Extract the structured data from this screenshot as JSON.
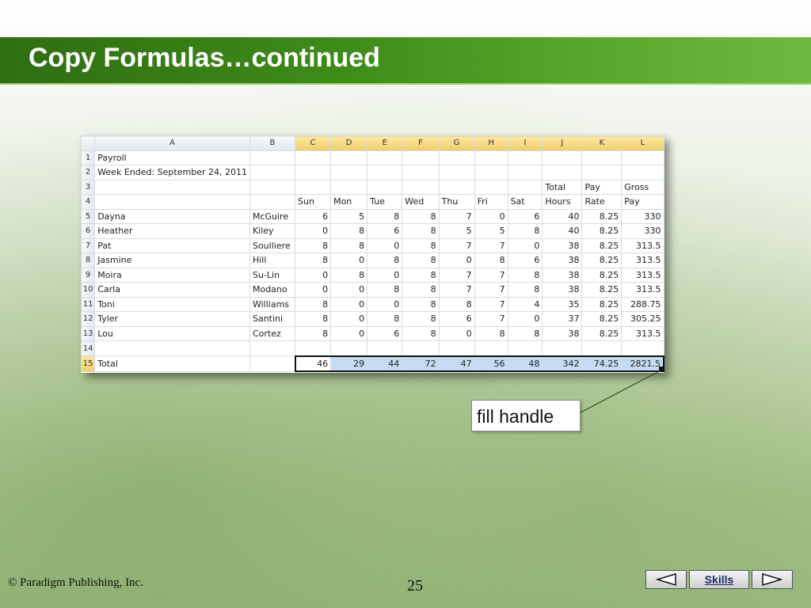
{
  "slide": {
    "title": "Copy Formulas…continued",
    "footer_copyright": "© Paradigm Publishing, Inc.",
    "page_number": "25",
    "callout": "fill handle",
    "nav": {
      "prev_icon": "left-triangle-icon",
      "skills_label": "Skills",
      "next_icon": "right-triangle-icon"
    },
    "colors": {
      "title_bar": "#3d8a19",
      "selection": "#c6dbf3",
      "header_selected": "#f2cd6a"
    }
  },
  "sheet": {
    "columns": [
      "A",
      "B",
      "C",
      "D",
      "E",
      "F",
      "G",
      "H",
      "I",
      "J",
      "K",
      "L"
    ],
    "rows": [
      {
        "n": "1",
        "cells": [
          "Payroll",
          "",
          "",
          "",
          "",
          "",
          "",
          "",
          "",
          "",
          "",
          ""
        ]
      },
      {
        "n": "2",
        "cells": [
          "Week Ended: September 24, 2011",
          "",
          "",
          "",
          "",
          "",
          "",
          "",
          "",
          "",
          "",
          ""
        ]
      },
      {
        "n": "3",
        "cells": [
          "",
          "",
          "",
          "",
          "",
          "",
          "",
          "",
          "",
          "Total",
          "Pay",
          "Gross"
        ]
      },
      {
        "n": "4",
        "cells": [
          "",
          "",
          "Sun",
          "Mon",
          "Tue",
          "Wed",
          "Thu",
          "Fri",
          "Sat",
          "Hours",
          "Rate",
          "Pay"
        ]
      },
      {
        "n": "5",
        "cells": [
          "Dayna",
          "McGuire",
          "6",
          "5",
          "8",
          "8",
          "7",
          "0",
          "6",
          "40",
          "8.25",
          "330"
        ]
      },
      {
        "n": "6",
        "cells": [
          "Heather",
          "Kiley",
          "0",
          "8",
          "6",
          "8",
          "5",
          "5",
          "8",
          "40",
          "8.25",
          "330"
        ]
      },
      {
        "n": "7",
        "cells": [
          "Pat",
          "Soulliere",
          "8",
          "8",
          "0",
          "8",
          "7",
          "7",
          "0",
          "38",
          "8.25",
          "313.5"
        ]
      },
      {
        "n": "8",
        "cells": [
          "Jasmine",
          "Hill",
          "8",
          "0",
          "8",
          "8",
          "0",
          "8",
          "6",
          "38",
          "8.25",
          "313.5"
        ]
      },
      {
        "n": "9",
        "cells": [
          "Moira",
          "Su-Lin",
          "0",
          "8",
          "0",
          "8",
          "7",
          "7",
          "8",
          "38",
          "8.25",
          "313.5"
        ]
      },
      {
        "n": "10",
        "cells": [
          "Carla",
          "Modano",
          "0",
          "0",
          "8",
          "8",
          "7",
          "7",
          "8",
          "38",
          "8.25",
          "313.5"
        ]
      },
      {
        "n": "11",
        "cells": [
          "Toni",
          "Williams",
          "8",
          "0",
          "0",
          "8",
          "8",
          "7",
          "4",
          "35",
          "8.25",
          "288.75"
        ]
      },
      {
        "n": "12",
        "cells": [
          "Tyler",
          "Santini",
          "8",
          "0",
          "8",
          "8",
          "6",
          "7",
          "0",
          "37",
          "8.25",
          "305.25"
        ]
      },
      {
        "n": "13",
        "cells": [
          "Lou",
          "Cortez",
          "8",
          "0",
          "6",
          "8",
          "0",
          "8",
          "8",
          "38",
          "8.25",
          "313.5"
        ]
      },
      {
        "n": "14",
        "cells": [
          "",
          "",
          "",
          "",
          "",
          "",
          "",
          "",
          "",
          "",
          "",
          ""
        ]
      },
      {
        "n": "15",
        "cells": [
          "Total",
          "",
          "46",
          "29",
          "44",
          "72",
          "47",
          "56",
          "48",
          "342",
          "74.25",
          "2821.5"
        ]
      }
    ]
  }
}
